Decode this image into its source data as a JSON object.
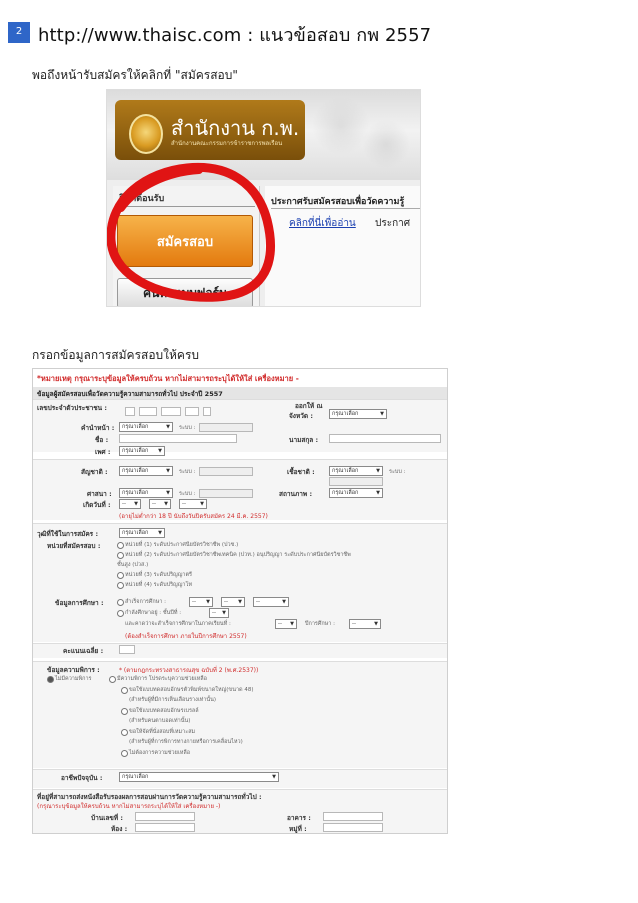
{
  "page": {
    "number": "2",
    "title": "http://www.thaisc.com : แนวข้อสอบ กพ 2557"
  },
  "captions": {
    "first": "พอถึงหน้ารับสมัครให้คลิกที่ \"สมัครสอบ\"",
    "second": "กรอกข้อมูลการสมัครสอบให้ครบ"
  },
  "screenshot1": {
    "logo_title": "สำนักงาน ก.พ.",
    "logo_subtitle": "สำนักงานคณะกรรมการข้าราชการพลเรือน",
    "welcome": "ยินดีต้อนรับ",
    "apply_button": "สมัครสอบ",
    "form_button": "ค้นหาแบบฟอร์ม",
    "announcement_title": "ประกาศรับสมัครสอบเพื่อวัดความรู้",
    "announcement_link": "คลิกที่นี่เพื่ออ่าน",
    "announcement_text": "ประกาศ",
    "highlight_color": "#e01414"
  },
  "screenshot2": {
    "note": "*หมายเหตุ กรุณาระบุข้อมูลให้ครบถ้วน หากไม่สามารถระบุได้ให้ใส่ เครื่องหมาย -",
    "header_line1": "ข้อมูลผู้สมัครสอบเพื่อวัดความรู้ความสามารถทั่วไป ประจำปี 2557",
    "labels": {
      "id_card": "เลขประจำตัวประชาชน :",
      "issued": "ออกให้ ณ",
      "province": "จังหวัด :",
      "prefix": "คำนำหน้า :",
      "name": "ชื่อ :",
      "surname": "นามสกุล :",
      "sex": "เพศ :",
      "nationality": "สัญชาติ :",
      "ethnicity": "เชื้อชาติ :",
      "religion": "ศาสนา :",
      "status": "สถานภาพ :",
      "birthdate": "เกิดวันที่ :",
      "qualification": "วุฒิที่ใช้ในการสมัคร :",
      "exam_unit": "หน่วยที่สมัครสอบ :",
      "education": "ข้อมูลการศึกษา :",
      "gpa": "คะแนนเฉลี่ย :",
      "disability": "ข้อมูลความพิการ :",
      "occupation": "อาชีพปัจจุบัน :",
      "address": "ที่อยู่ที่สามารถส่งหนังสือรับรองผลการสอบผ่านการวัดความรู้ความสามารถทั่วไป :",
      "house_no": "บ้านเลขที่ :",
      "building": "อาคาร :",
      "room": "ห้อง :",
      "village_no": "หมู่ที่ :"
    },
    "select_placeholder": "กรุณาเลือก",
    "dash": "--",
    "sequence_label": "ระบบ :",
    "age_note": "(อายุไม่ต่ำกว่า 18 ปี นับถึงวันปิดรับสมัคร 24 มี.ค. 2557)",
    "units": [
      "หน่วยที่ (1) ระดับประกาศนียบัตรวิชาชีพ (ปวช.)",
      "หน่วยที่ (2) ระดับประกาศนียบัตรวิชาชีพเทคนิค (ปวท.) อนุปริญญา ระดับประกาศนียบัตรวิชาชีพ",
      "ชั้นสูง (ปวส.)",
      "หน่วยที่ (3) ระดับปริญญาตรี",
      "หน่วยที่ (4) ระดับปริญญาโท"
    ],
    "education_graduated": "สำเร็จการศึกษา :",
    "education_studying": "กำลังศึกษาอยู่ : ชั้นปีที่ :",
    "education_expected": "และคาดว่าจะสำเร็จการศึกษาในภาคเรียนที่ :",
    "education_year": "ปีการศึกษา :",
    "education_note": "(ต้องสำเร็จการศึกษา ภายในปีการศึกษา 2557)",
    "disability_note": "* (ตามกฎกระทรวงสาธารณสุข ฉบับที่ 2 (พ.ศ.2537))",
    "disability_none": "ไม่มีความพิการ",
    "disability_has": "มีความพิการ โปรดระบุความช่วยเหลือ",
    "help_options": [
      "ขอใช้แบบทดสอบอักษรตัวพิมพ์ขนาดใหญ่(ขนาด 48)",
      "(สำหรับผู้ที่มีการเห็นเลือนรางเท่านั้น)",
      "ขอใช้แบบทดสอบอักษรเบรลล์",
      "(สำหรับคนตาบอดเท่านั้น)",
      "ขอให้จัดที่นั่งสอบที่เหมาะสม",
      "(สำหรับผู้ที่การพิการทางกายหรือการเคลื่อนไหว)",
      "ไม่ต้องการความช่วยเหลือ"
    ],
    "address_note": "(กรุณาระบุข้อมูลให้ครบถ้วน หากไม่สามารถระบุได้ให้ใส่ เครื่องหมาย -)"
  }
}
